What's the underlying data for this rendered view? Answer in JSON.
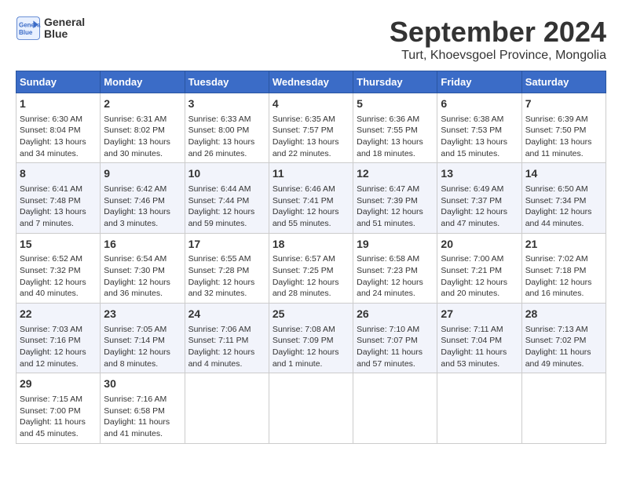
{
  "header": {
    "logo_line1": "General",
    "logo_line2": "Blue",
    "title": "September 2024",
    "subtitle": "Turt, Khoevsgoel Province, Mongolia"
  },
  "days_of_week": [
    "Sunday",
    "Monday",
    "Tuesday",
    "Wednesday",
    "Thursday",
    "Friday",
    "Saturday"
  ],
  "weeks": [
    [
      {
        "day": 1,
        "lines": [
          "Sunrise: 6:30 AM",
          "Sunset: 8:04 PM",
          "Daylight: 13 hours",
          "and 34 minutes."
        ]
      },
      {
        "day": 2,
        "lines": [
          "Sunrise: 6:31 AM",
          "Sunset: 8:02 PM",
          "Daylight: 13 hours",
          "and 30 minutes."
        ]
      },
      {
        "day": 3,
        "lines": [
          "Sunrise: 6:33 AM",
          "Sunset: 8:00 PM",
          "Daylight: 13 hours",
          "and 26 minutes."
        ]
      },
      {
        "day": 4,
        "lines": [
          "Sunrise: 6:35 AM",
          "Sunset: 7:57 PM",
          "Daylight: 13 hours",
          "and 22 minutes."
        ]
      },
      {
        "day": 5,
        "lines": [
          "Sunrise: 6:36 AM",
          "Sunset: 7:55 PM",
          "Daylight: 13 hours",
          "and 18 minutes."
        ]
      },
      {
        "day": 6,
        "lines": [
          "Sunrise: 6:38 AM",
          "Sunset: 7:53 PM",
          "Daylight: 13 hours",
          "and 15 minutes."
        ]
      },
      {
        "day": 7,
        "lines": [
          "Sunrise: 6:39 AM",
          "Sunset: 7:50 PM",
          "Daylight: 13 hours",
          "and 11 minutes."
        ]
      }
    ],
    [
      {
        "day": 8,
        "lines": [
          "Sunrise: 6:41 AM",
          "Sunset: 7:48 PM",
          "Daylight: 13 hours",
          "and 7 minutes."
        ]
      },
      {
        "day": 9,
        "lines": [
          "Sunrise: 6:42 AM",
          "Sunset: 7:46 PM",
          "Daylight: 13 hours",
          "and 3 minutes."
        ]
      },
      {
        "day": 10,
        "lines": [
          "Sunrise: 6:44 AM",
          "Sunset: 7:44 PM",
          "Daylight: 12 hours",
          "and 59 minutes."
        ]
      },
      {
        "day": 11,
        "lines": [
          "Sunrise: 6:46 AM",
          "Sunset: 7:41 PM",
          "Daylight: 12 hours",
          "and 55 minutes."
        ]
      },
      {
        "day": 12,
        "lines": [
          "Sunrise: 6:47 AM",
          "Sunset: 7:39 PM",
          "Daylight: 12 hours",
          "and 51 minutes."
        ]
      },
      {
        "day": 13,
        "lines": [
          "Sunrise: 6:49 AM",
          "Sunset: 7:37 PM",
          "Daylight: 12 hours",
          "and 47 minutes."
        ]
      },
      {
        "day": 14,
        "lines": [
          "Sunrise: 6:50 AM",
          "Sunset: 7:34 PM",
          "Daylight: 12 hours",
          "and 44 minutes."
        ]
      }
    ],
    [
      {
        "day": 15,
        "lines": [
          "Sunrise: 6:52 AM",
          "Sunset: 7:32 PM",
          "Daylight: 12 hours",
          "and 40 minutes."
        ]
      },
      {
        "day": 16,
        "lines": [
          "Sunrise: 6:54 AM",
          "Sunset: 7:30 PM",
          "Daylight: 12 hours",
          "and 36 minutes."
        ]
      },
      {
        "day": 17,
        "lines": [
          "Sunrise: 6:55 AM",
          "Sunset: 7:28 PM",
          "Daylight: 12 hours",
          "and 32 minutes."
        ]
      },
      {
        "day": 18,
        "lines": [
          "Sunrise: 6:57 AM",
          "Sunset: 7:25 PM",
          "Daylight: 12 hours",
          "and 28 minutes."
        ]
      },
      {
        "day": 19,
        "lines": [
          "Sunrise: 6:58 AM",
          "Sunset: 7:23 PM",
          "Daylight: 12 hours",
          "and 24 minutes."
        ]
      },
      {
        "day": 20,
        "lines": [
          "Sunrise: 7:00 AM",
          "Sunset: 7:21 PM",
          "Daylight: 12 hours",
          "and 20 minutes."
        ]
      },
      {
        "day": 21,
        "lines": [
          "Sunrise: 7:02 AM",
          "Sunset: 7:18 PM",
          "Daylight: 12 hours",
          "and 16 minutes."
        ]
      }
    ],
    [
      {
        "day": 22,
        "lines": [
          "Sunrise: 7:03 AM",
          "Sunset: 7:16 PM",
          "Daylight: 12 hours",
          "and 12 minutes."
        ]
      },
      {
        "day": 23,
        "lines": [
          "Sunrise: 7:05 AM",
          "Sunset: 7:14 PM",
          "Daylight: 12 hours",
          "and 8 minutes."
        ]
      },
      {
        "day": 24,
        "lines": [
          "Sunrise: 7:06 AM",
          "Sunset: 7:11 PM",
          "Daylight: 12 hours",
          "and 4 minutes."
        ]
      },
      {
        "day": 25,
        "lines": [
          "Sunrise: 7:08 AM",
          "Sunset: 7:09 PM",
          "Daylight: 12 hours",
          "and 1 minute."
        ]
      },
      {
        "day": 26,
        "lines": [
          "Sunrise: 7:10 AM",
          "Sunset: 7:07 PM",
          "Daylight: 11 hours",
          "and 57 minutes."
        ]
      },
      {
        "day": 27,
        "lines": [
          "Sunrise: 7:11 AM",
          "Sunset: 7:04 PM",
          "Daylight: 11 hours",
          "and 53 minutes."
        ]
      },
      {
        "day": 28,
        "lines": [
          "Sunrise: 7:13 AM",
          "Sunset: 7:02 PM",
          "Daylight: 11 hours",
          "and 49 minutes."
        ]
      }
    ],
    [
      {
        "day": 29,
        "lines": [
          "Sunrise: 7:15 AM",
          "Sunset: 7:00 PM",
          "Daylight: 11 hours",
          "and 45 minutes."
        ]
      },
      {
        "day": 30,
        "lines": [
          "Sunrise: 7:16 AM",
          "Sunset: 6:58 PM",
          "Daylight: 11 hours",
          "and 41 minutes."
        ]
      },
      null,
      null,
      null,
      null,
      null
    ]
  ]
}
